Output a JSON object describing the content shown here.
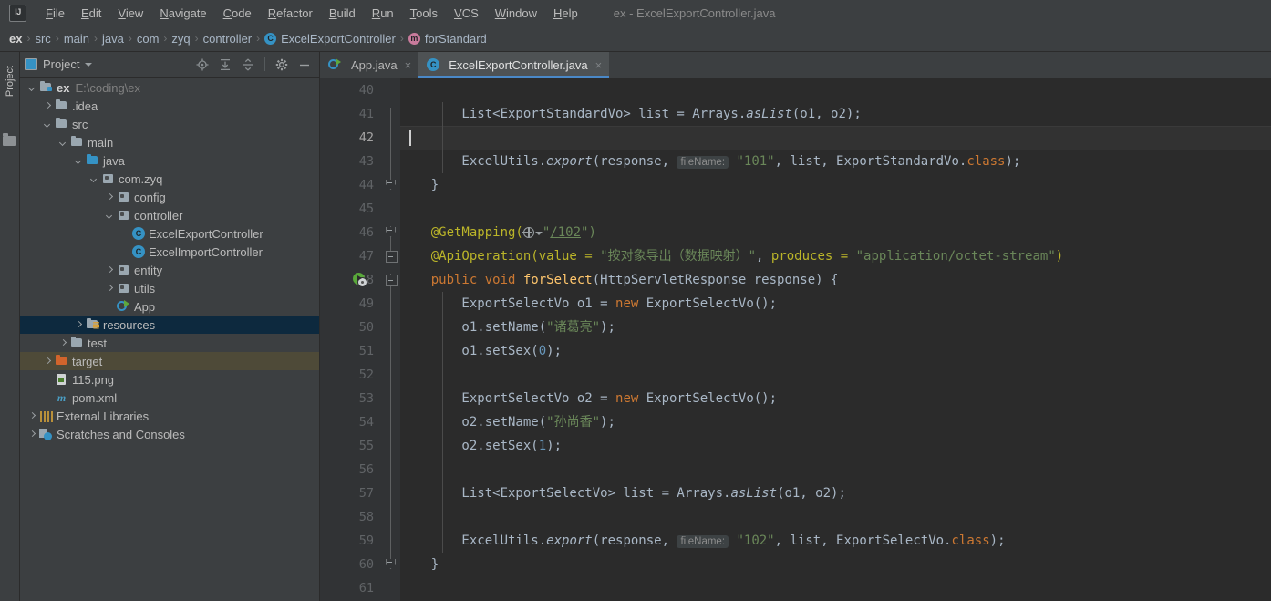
{
  "window": {
    "title": "ex - ExcelExportController.java"
  },
  "menu": {
    "logo": "IJ",
    "items": [
      "File",
      "Edit",
      "View",
      "Navigate",
      "Code",
      "Refactor",
      "Build",
      "Run",
      "Tools",
      "VCS",
      "Window",
      "Help"
    ]
  },
  "breadcrumb": {
    "items": [
      {
        "label": "ex",
        "icon": ""
      },
      {
        "label": "src",
        "icon": ""
      },
      {
        "label": "main",
        "icon": ""
      },
      {
        "label": "java",
        "icon": ""
      },
      {
        "label": "com",
        "icon": ""
      },
      {
        "label": "zyq",
        "icon": ""
      },
      {
        "label": "controller",
        "icon": ""
      },
      {
        "label": "ExcelExportController",
        "icon": "class-circle-icon"
      },
      {
        "label": "forStandard",
        "icon": "method-circle-icon"
      }
    ]
  },
  "tool_window_tab": {
    "label": "Project"
  },
  "project_panel": {
    "title": "Project",
    "toolbar": [
      "locate-icon",
      "expand-all-icon",
      "collapse-all-icon",
      "gear-icon",
      "minimize-icon"
    ],
    "tree": [
      {
        "indent": 0,
        "arrow": "down",
        "icon": "module-folder-icon",
        "label": "ex",
        "bold": true,
        "path": "E:\\coding\\ex",
        "state": "normal"
      },
      {
        "indent": 1,
        "arrow": "right",
        "icon": "folder-icon",
        "label": ".idea",
        "state": "normal"
      },
      {
        "indent": 1,
        "arrow": "down",
        "icon": "folder-icon",
        "label": "src",
        "state": "normal"
      },
      {
        "indent": 2,
        "arrow": "down",
        "icon": "folder-icon",
        "label": "main",
        "state": "normal"
      },
      {
        "indent": 3,
        "arrow": "down",
        "icon": "source-folder-icon",
        "label": "java",
        "state": "normal"
      },
      {
        "indent": 4,
        "arrow": "down",
        "icon": "package-icon",
        "label": "com.zyq",
        "state": "normal"
      },
      {
        "indent": 5,
        "arrow": "right",
        "icon": "package-icon",
        "label": "config",
        "state": "normal"
      },
      {
        "indent": 5,
        "arrow": "down",
        "icon": "package-icon",
        "label": "controller",
        "state": "normal"
      },
      {
        "indent": 6,
        "arrow": "none",
        "icon": "class-icon",
        "label": "ExcelExportController",
        "state": "normal"
      },
      {
        "indent": 6,
        "arrow": "none",
        "icon": "class-icon",
        "label": "ExcelImportController",
        "state": "normal"
      },
      {
        "indent": 5,
        "arrow": "right",
        "icon": "package-icon",
        "label": "entity",
        "state": "normal"
      },
      {
        "indent": 5,
        "arrow": "right",
        "icon": "package-icon",
        "label": "utils",
        "state": "normal"
      },
      {
        "indent": 5,
        "arrow": "none",
        "icon": "runnable-class-icon",
        "label": "App",
        "state": "normal"
      },
      {
        "indent": 3,
        "arrow": "right",
        "icon": "resources-folder-icon",
        "label": "resources",
        "state": "selected"
      },
      {
        "indent": 2,
        "arrow": "right",
        "icon": "folder-icon",
        "label": "test",
        "state": "normal"
      },
      {
        "indent": 1,
        "arrow": "right",
        "icon": "excluded-folder-icon",
        "label": "target",
        "state": "highlighted"
      },
      {
        "indent": 1,
        "arrow": "none",
        "icon": "png-file-icon",
        "label": "115.png",
        "state": "normal"
      },
      {
        "indent": 1,
        "arrow": "none",
        "icon": "maven-file-icon",
        "label": "pom.xml",
        "state": "normal"
      },
      {
        "indent": 0,
        "arrow": "right",
        "icon": "libraries-icon",
        "label": "External Libraries",
        "state": "normal"
      },
      {
        "indent": 0,
        "arrow": "right",
        "icon": "scratches-icon",
        "label": "Scratches and Consoles",
        "state": "normal"
      }
    ]
  },
  "editor": {
    "tabs": [
      {
        "label": "App.java",
        "icon": "runnable-class-icon",
        "active": false
      },
      {
        "label": "ExcelExportController.java",
        "icon": "class-icon",
        "active": true
      }
    ],
    "close_glyph": "×",
    "first_line_number": 40,
    "current_line": 42,
    "lines": [
      {
        "n": 40,
        "indent_guides": [],
        "tokens": []
      },
      {
        "n": 41,
        "indent_guides": [
          46
        ],
        "tokens": [
          {
            "t": "        List<ExportStandardVo> list = Arrays.",
            "c": "pl"
          },
          {
            "t": "asList",
            "c": "mi"
          },
          {
            "t": "(o1, o2)",
            "c": "pl"
          },
          {
            "t": ";",
            "c": "pl"
          }
        ]
      },
      {
        "n": 42,
        "indent_guides": [
          46
        ],
        "tokens": []
      },
      {
        "n": 43,
        "indent_guides": [
          46
        ],
        "tokens": [
          {
            "t": "        ExcelUtils.",
            "c": "pl"
          },
          {
            "t": "export",
            "c": "mi"
          },
          {
            "t": "(response, ",
            "c": "pl"
          },
          {
            "t": "fileName:",
            "c": "hint"
          },
          {
            "t": " ",
            "c": "pl"
          },
          {
            "t": "\"101\"",
            "c": "str"
          },
          {
            "t": ", list, ExportStandardVo.",
            "c": "pl"
          },
          {
            "t": "class",
            "c": "kw"
          },
          {
            "t": ");",
            "c": "pl"
          }
        ]
      },
      {
        "n": 44,
        "indent_guides": [],
        "tokens": [
          {
            "t": "    }",
            "c": "pl"
          }
        ]
      },
      {
        "n": 45,
        "indent_guides": [],
        "tokens": []
      },
      {
        "n": 46,
        "indent_guides": [],
        "tokens": [
          {
            "t": "    @GetMapping(",
            "c": "ann"
          },
          {
            "t": "globe-icon",
            "c": "globe"
          },
          {
            "t": "\"",
            "c": "str"
          },
          {
            "t": "/102",
            "c": "ulink"
          },
          {
            "t": "\")",
            "c": "str"
          }
        ]
      },
      {
        "n": 47,
        "indent_guides": [],
        "tokens": [
          {
            "t": "    @ApiOperation(",
            "c": "ann"
          },
          {
            "t": "value",
            "c": "ann"
          },
          {
            "t": " = ",
            "c": "ann"
          },
          {
            "t": "\"按对象导出（数据映射）\"",
            "c": "str"
          },
          {
            "t": ", ",
            "c": "pl"
          },
          {
            "t": "produces",
            "c": "ann"
          },
          {
            "t": " = ",
            "c": "ann"
          },
          {
            "t": "\"application/octet-stream\"",
            "c": "str"
          },
          {
            "t": ")",
            "c": "ann"
          }
        ]
      },
      {
        "n": 48,
        "indent_guides": [],
        "gutter_icon": "run-method-icon",
        "tokens": [
          {
            "t": "    ",
            "c": "pl"
          },
          {
            "t": "public void ",
            "c": "kw"
          },
          {
            "t": "forSelect",
            "c": "fn"
          },
          {
            "t": "(HttpServletResponse response) {",
            "c": "pl"
          }
        ]
      },
      {
        "n": 49,
        "indent_guides": [
          46
        ],
        "tokens": [
          {
            "t": "        ExportSelectVo o1 = ",
            "c": "pl"
          },
          {
            "t": "new",
            "c": "kw"
          },
          {
            "t": " ExportSelectVo();",
            "c": "pl"
          }
        ]
      },
      {
        "n": 50,
        "indent_guides": [
          46
        ],
        "tokens": [
          {
            "t": "        o1.setName(",
            "c": "pl"
          },
          {
            "t": "\"诸葛亮\"",
            "c": "str"
          },
          {
            "t": ");",
            "c": "pl"
          }
        ]
      },
      {
        "n": 51,
        "indent_guides": [
          46
        ],
        "tokens": [
          {
            "t": "        o1.setSex(",
            "c": "pl"
          },
          {
            "t": "0",
            "c": "num"
          },
          {
            "t": ");",
            "c": "pl"
          }
        ]
      },
      {
        "n": 52,
        "indent_guides": [
          46
        ],
        "tokens": []
      },
      {
        "n": 53,
        "indent_guides": [
          46
        ],
        "tokens": [
          {
            "t": "        ExportSelectVo o2 = ",
            "c": "pl"
          },
          {
            "t": "new",
            "c": "kw"
          },
          {
            "t": " ExportSelectVo();",
            "c": "pl"
          }
        ]
      },
      {
        "n": 54,
        "indent_guides": [
          46
        ],
        "tokens": [
          {
            "t": "        o2.setName(",
            "c": "pl"
          },
          {
            "t": "\"孙尚香\"",
            "c": "str"
          },
          {
            "t": ");",
            "c": "pl"
          }
        ]
      },
      {
        "n": 55,
        "indent_guides": [
          46
        ],
        "tokens": [
          {
            "t": "        o2.setSex(",
            "c": "pl"
          },
          {
            "t": "1",
            "c": "num"
          },
          {
            "t": ");",
            "c": "pl"
          }
        ]
      },
      {
        "n": 56,
        "indent_guides": [
          46
        ],
        "tokens": []
      },
      {
        "n": 57,
        "indent_guides": [
          46
        ],
        "tokens": [
          {
            "t": "        List<ExportSelectVo> list = Arrays.",
            "c": "pl"
          },
          {
            "t": "asList",
            "c": "mi"
          },
          {
            "t": "(o1, o2);",
            "c": "pl"
          }
        ]
      },
      {
        "n": 58,
        "indent_guides": [
          46
        ],
        "tokens": []
      },
      {
        "n": 59,
        "indent_guides": [
          46
        ],
        "tokens": [
          {
            "t": "        ExcelUtils.",
            "c": "pl"
          },
          {
            "t": "export",
            "c": "mi"
          },
          {
            "t": "(response, ",
            "c": "pl"
          },
          {
            "t": "fileName:",
            "c": "hint"
          },
          {
            "t": " ",
            "c": "pl"
          },
          {
            "t": "\"102\"",
            "c": "str"
          },
          {
            "t": ", list, ExportSelectVo.",
            "c": "pl"
          },
          {
            "t": "class",
            "c": "kw"
          },
          {
            "t": ");",
            "c": "pl"
          }
        ]
      },
      {
        "n": 60,
        "indent_guides": [],
        "tokens": [
          {
            "t": "    }",
            "c": "pl"
          }
        ]
      },
      {
        "n": 61,
        "indent_guides": [],
        "tokens": []
      }
    ],
    "fold_markers": [
      {
        "line": 44,
        "type": "end"
      },
      {
        "line": 46,
        "type": "end"
      },
      {
        "line": 47,
        "type": "collapse"
      },
      {
        "line": 48,
        "type": "collapse"
      },
      {
        "line": 60,
        "type": "end"
      }
    ]
  },
  "colors": {
    "panel_bg": "#3c3f41",
    "editor_bg": "#2b2b2b",
    "gutter_bg": "#313335",
    "accent": "#4a88c7",
    "selection": "#0d293e",
    "excluded": "#4e4a38",
    "keyword": "#cc7832",
    "string": "#6a8759",
    "number": "#6897bb",
    "annotation": "#bbb529",
    "method": "#ffc66d",
    "default_text": "#a9b7c6"
  }
}
